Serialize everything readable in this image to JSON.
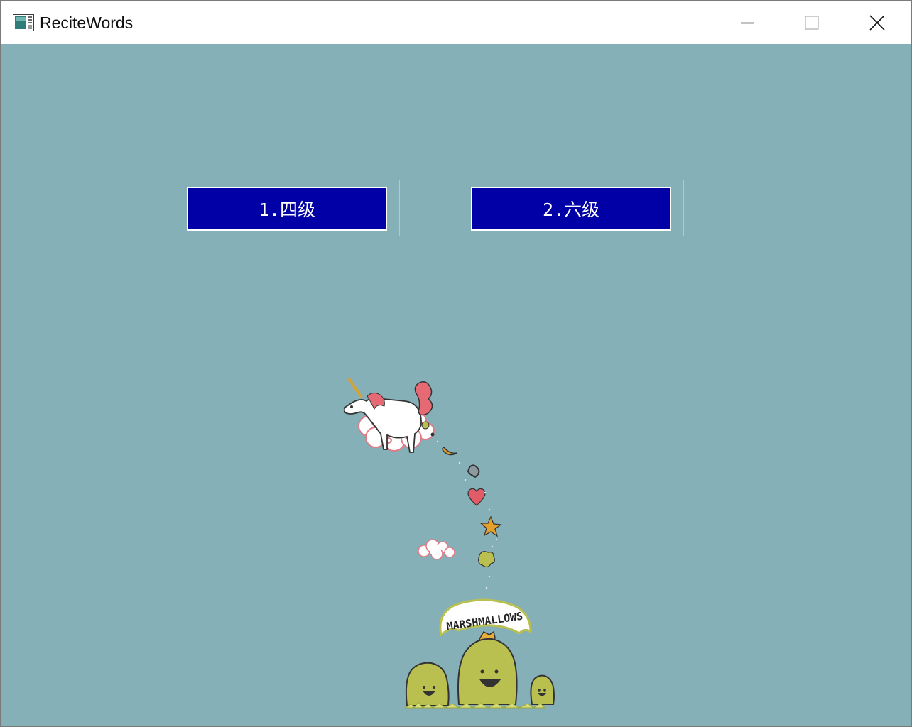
{
  "window": {
    "title": "ReciteWords",
    "controls": {
      "minimize": "minimize",
      "maximize": "maximize",
      "close": "close"
    }
  },
  "menu": {
    "cet4_label": "1.四级",
    "cet6_label": "2.六级"
  },
  "illustration": {
    "banner_text": "MARSHMALLOWS"
  },
  "colors": {
    "client_background": "#85b0b7",
    "button_fill": "#0000a6",
    "button_outline": "#52f3f5"
  }
}
